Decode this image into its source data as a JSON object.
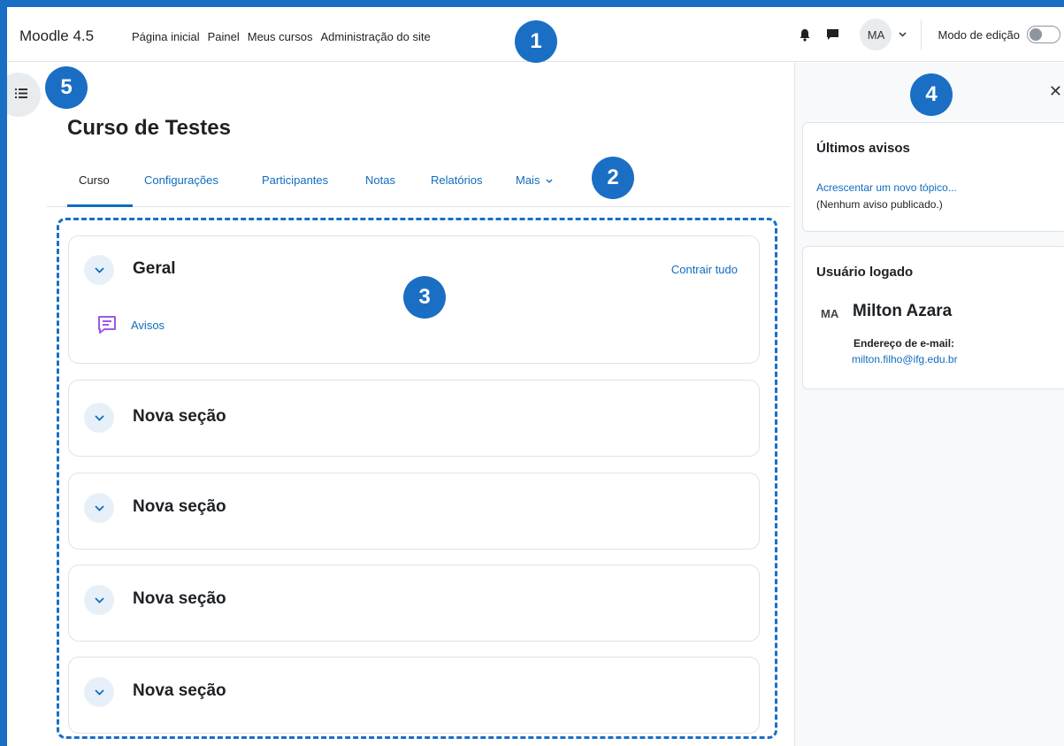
{
  "navbar": {
    "brand": "Moodle 4.5",
    "links": [
      "Página inicial",
      "Painel",
      "Meus cursos",
      "Administração do site"
    ],
    "avatar_initials": "MA",
    "edit_mode_label": "Modo de edição"
  },
  "course": {
    "title": "Curso de Testes",
    "tabs": [
      "Curso",
      "Configurações",
      "Participantes",
      "Notas",
      "Relatórios",
      "Mais"
    ],
    "active_tab": "Curso"
  },
  "content": {
    "collapse_all": "Contrair tudo",
    "sections": [
      {
        "title": "Geral",
        "activities": [
          {
            "name": "Avisos",
            "icon": "forum-icon"
          }
        ]
      },
      {
        "title": "Nova seção"
      },
      {
        "title": "Nova seção"
      },
      {
        "title": "Nova seção"
      },
      {
        "title": "Nova seção"
      }
    ]
  },
  "right_drawer": {
    "blocks": [
      {
        "title": "Últimos avisos",
        "link": "Acrescentar um novo tópico...",
        "text": "(Nenhum aviso publicado.)"
      },
      {
        "title": "Usuário logado",
        "initials": "MA",
        "name": "Milton Azara",
        "email_label": "Endereço de e-mail:",
        "email": "milton.filho@ifg.edu.br"
      }
    ]
  },
  "callouts": [
    "1",
    "2",
    "3",
    "4",
    "5"
  ],
  "colors": {
    "accent": "#1a6fc4",
    "link": "#0f6cbf",
    "text": "#1d2125",
    "forum_icon": "#9b59e8"
  }
}
